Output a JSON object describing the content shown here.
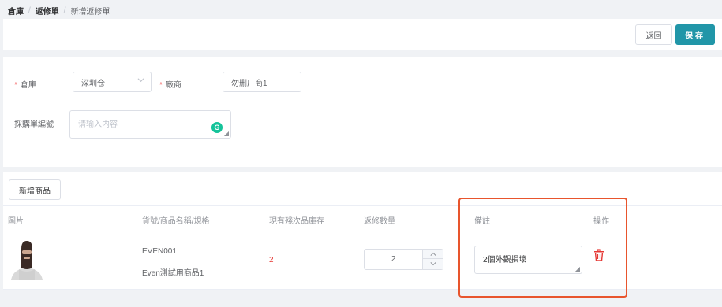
{
  "breadcrumb": {
    "root": "倉庫",
    "parent": "返修單",
    "current": "新增返修單",
    "separator": "/"
  },
  "actions": {
    "back_label": "返回",
    "save_label": "保存"
  },
  "form": {
    "warehouse_label": "倉庫",
    "warehouse_value": "深圳仓",
    "vendor_label": "廠商",
    "vendor_value": "勿删厂商1",
    "po_label": "採購單編號",
    "po_placeholder": "请输入内容",
    "required_mark": "*"
  },
  "table": {
    "add_button_label": "新增商品",
    "headers": {
      "image": "圖片",
      "product": "貨號/商品名稱/規格",
      "stock": "現有殘次品庫存",
      "qty": "返修數量",
      "note": "備註",
      "ops": "操作"
    },
    "rows": [
      {
        "sku": "EVEN001",
        "name": "Even測試用商品1",
        "stock": "2",
        "qty": "2",
        "note": "2個外觀損壞"
      }
    ]
  },
  "colors": {
    "primary": "#2196a8",
    "danger": "#e53935",
    "highlight": "#e8552d"
  },
  "icons": {
    "select_arrow": "chevron-down-icon",
    "delete": "trash-icon",
    "grammarly": "grammarly-icon"
  }
}
